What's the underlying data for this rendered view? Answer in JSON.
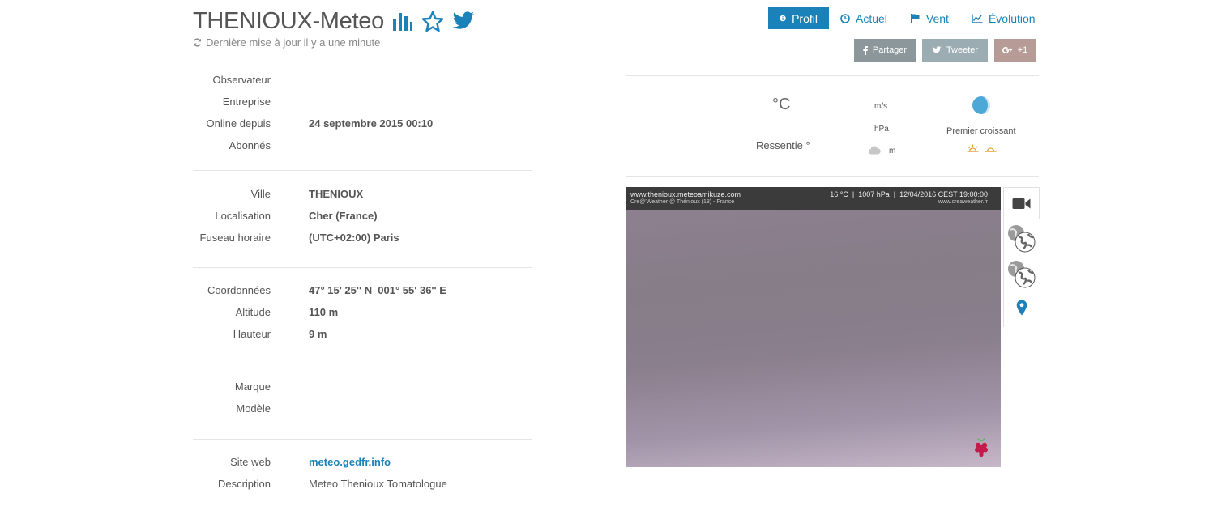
{
  "header": {
    "title": "THENIOUX-Meteo",
    "updated": "Dernière mise à jour il y a une minute"
  },
  "nav": {
    "profil": "Profil",
    "actuel": "Actuel",
    "vent": "Vent",
    "evolution": "Évolution"
  },
  "share": {
    "facebook": "Partager",
    "twitter": "Tweeter",
    "gplus": "+1"
  },
  "info": {
    "observateur_label": "Observateur",
    "entreprise_label": "Entreprise",
    "online_label": "Online depuis",
    "online_value": "24 septembre 2015 00:10",
    "abonnes_label": "Abonnés",
    "ville_label": "Ville",
    "ville_value": "THENIOUX",
    "localisation_label": "Localisation",
    "localisation_value": "Cher (France)",
    "fuseau_label": "Fuseau horaire",
    "fuseau_value": "(UTC+02:00) Paris",
    "coordonnees_label": "Coordonnées",
    "coordonnees_value": "47° 15' 25'' N  001° 55' 36'' E",
    "altitude_label": "Altitude",
    "altitude_value": "110 m",
    "hauteur_label": "Hauteur",
    "hauteur_value": "9 m",
    "marque_label": "Marque",
    "modele_label": "Modèle",
    "site_label": "Site web",
    "site_value": "meteo.gedfr.info",
    "description_label": "Description",
    "description_value": "Meteo Thenioux Tomatologue"
  },
  "weather": {
    "temp_unit": "°C",
    "ressentie": "Ressentie °",
    "wind_unit": "m/s",
    "pressure_unit": "hPa",
    "cloud_unit": "m",
    "moon_phase": "Premier croissant"
  },
  "webcam": {
    "site": "www.thenioux.meteoamikuze.com",
    "credit": "Cre@'Weather @ Thénioux (18) - France",
    "readout": "16 °C  |  1007 hPa  |  12/04/2016 CEST 19:00:00",
    "brand_site": "www.creaweather.fr"
  },
  "colors": {
    "accent": "#1a82b8",
    "facebook": "#8c979b",
    "twitter": "#9cacb3",
    "gplus": "#b69b97"
  }
}
